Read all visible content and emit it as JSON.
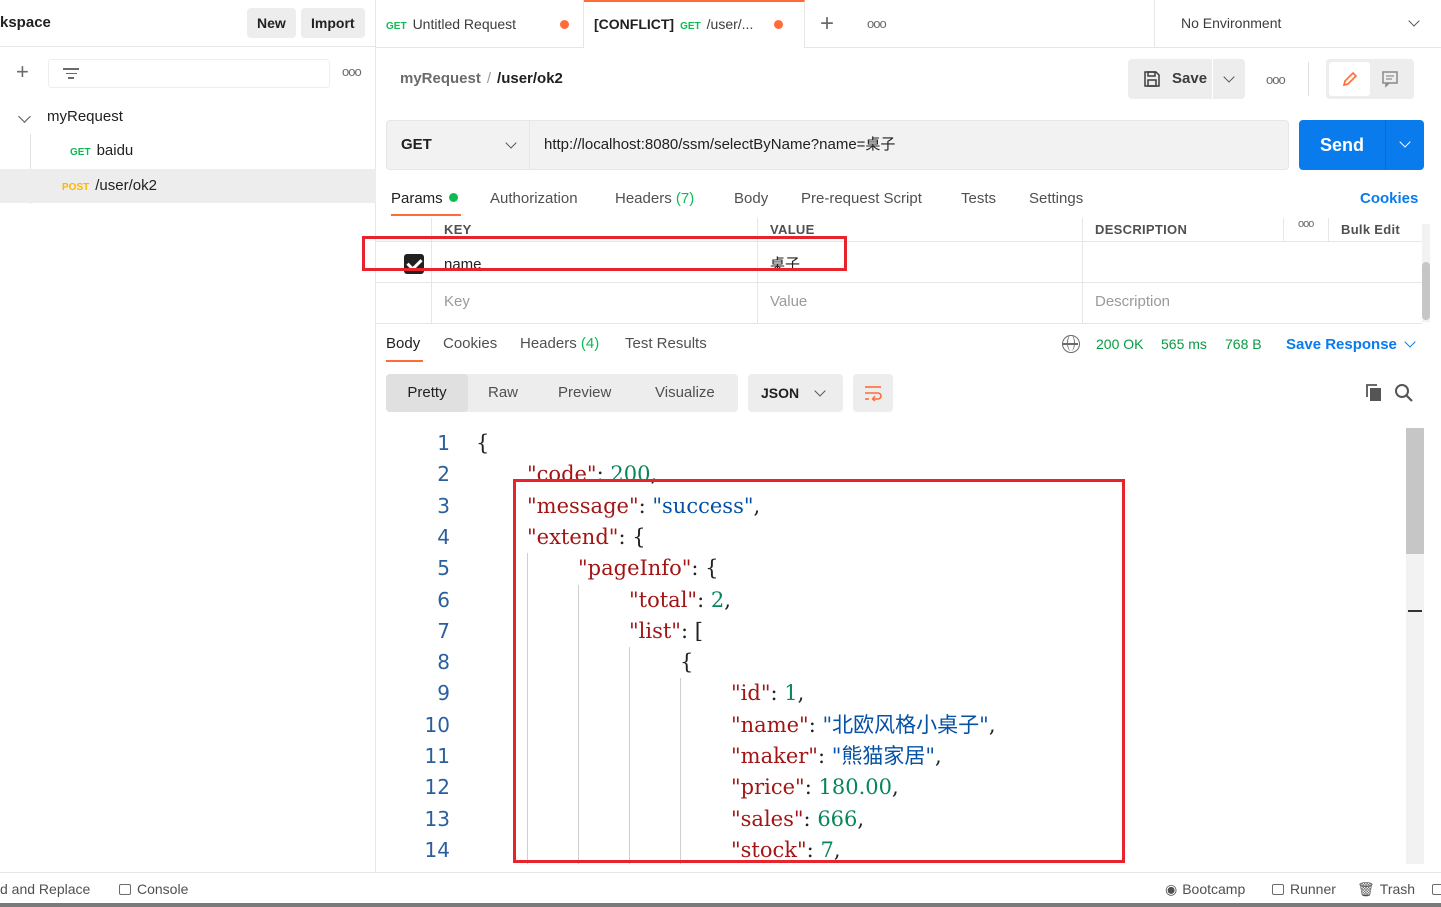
{
  "sidebar": {
    "workspace_title": "kspace",
    "new_label": "New",
    "import_label": "Import",
    "collection_name": "myRequest",
    "items": [
      {
        "method": "GET",
        "name": "baidu"
      },
      {
        "method": "POST",
        "name": "/user/ok2"
      }
    ]
  },
  "tabs": [
    {
      "method": "GET",
      "title": "Untitled Request",
      "prefix": ""
    },
    {
      "method": "GET",
      "title": "/user/...",
      "prefix": "[CONFLICT]"
    }
  ],
  "environment": "No Environment",
  "breadcrumb": {
    "parent": "myRequest",
    "separator": "/",
    "current": "/user/ok2"
  },
  "toolbar": {
    "save_label": "Save"
  },
  "request": {
    "method": "GET",
    "url": "http://localhost:8080/ssm/selectByName?name=桌子",
    "send_label": "Send"
  },
  "request_tabs": {
    "params": "Params",
    "authorization": "Authorization",
    "headers": "Headers",
    "headers_count": "(7)",
    "body": "Body",
    "prerequest": "Pre-request Script",
    "tests": "Tests",
    "settings": "Settings",
    "cookies": "Cookies"
  },
  "params_table": {
    "headers": {
      "key": "KEY",
      "value": "VALUE",
      "description": "DESCRIPTION",
      "bulk_edit": "Bulk Edit"
    },
    "rows": [
      {
        "key": "name",
        "value": "桌子",
        "checked": true
      }
    ],
    "placeholders": {
      "key": "Key",
      "value": "Value",
      "description": "Description"
    }
  },
  "response": {
    "tabs": {
      "body": "Body",
      "cookies": "Cookies",
      "headers": "Headers",
      "headers_count": "(4)",
      "test_results": "Test Results"
    },
    "status": "200 OK",
    "time": "565 ms",
    "size": "768 B",
    "save_response": "Save Response",
    "views": {
      "pretty": "Pretty",
      "raw": "Raw",
      "preview": "Preview",
      "visualize": "Visualize"
    },
    "format": "JSON",
    "code_lines": [
      {
        "n": "1",
        "ind": 0,
        "parts": [
          [
            "p",
            "{"
          ]
        ]
      },
      {
        "n": "2",
        "ind": 1,
        "parts": [
          [
            "k",
            "\"code\""
          ],
          [
            "p",
            ": "
          ],
          [
            "n",
            "200"
          ],
          [
            "p",
            ","
          ]
        ]
      },
      {
        "n": "3",
        "ind": 1,
        "parts": [
          [
            "k",
            "\"message\""
          ],
          [
            "p",
            ": "
          ],
          [
            "s",
            "\"success\""
          ],
          [
            "p",
            ","
          ]
        ]
      },
      {
        "n": "4",
        "ind": 1,
        "parts": [
          [
            "k",
            "\"extend\""
          ],
          [
            "p",
            ": {"
          ]
        ]
      },
      {
        "n": "5",
        "ind": 2,
        "parts": [
          [
            "k",
            "\"pageInfo\""
          ],
          [
            "p",
            ": {"
          ]
        ]
      },
      {
        "n": "6",
        "ind": 3,
        "parts": [
          [
            "k",
            "\"total\""
          ],
          [
            "p",
            ": "
          ],
          [
            "n",
            "2"
          ],
          [
            "p",
            ","
          ]
        ]
      },
      {
        "n": "7",
        "ind": 3,
        "parts": [
          [
            "k",
            "\"list\""
          ],
          [
            "p",
            ": ["
          ]
        ]
      },
      {
        "n": "8",
        "ind": 4,
        "parts": [
          [
            "p",
            "{"
          ]
        ]
      },
      {
        "n": "9",
        "ind": 5,
        "parts": [
          [
            "k",
            "\"id\""
          ],
          [
            "p",
            ": "
          ],
          [
            "n",
            "1"
          ],
          [
            "p",
            ","
          ]
        ]
      },
      {
        "n": "10",
        "ind": 5,
        "parts": [
          [
            "k",
            "\"name\""
          ],
          [
            "p",
            ": "
          ],
          [
            "s",
            "\"北欧风格小桌子\""
          ],
          [
            "p",
            ","
          ]
        ]
      },
      {
        "n": "11",
        "ind": 5,
        "parts": [
          [
            "k",
            "\"maker\""
          ],
          [
            "p",
            ": "
          ],
          [
            "s",
            "\"熊猫家居\""
          ],
          [
            "p",
            ","
          ]
        ]
      },
      {
        "n": "12",
        "ind": 5,
        "parts": [
          [
            "k",
            "\"price\""
          ],
          [
            "p",
            ": "
          ],
          [
            "n",
            "180.00"
          ],
          [
            "p",
            ","
          ]
        ]
      },
      {
        "n": "13",
        "ind": 5,
        "parts": [
          [
            "k",
            "\"sales\""
          ],
          [
            "p",
            ": "
          ],
          [
            "n",
            "666"
          ],
          [
            "p",
            ","
          ]
        ]
      },
      {
        "n": "14",
        "ind": 5,
        "parts": [
          [
            "k",
            "\"stock\""
          ],
          [
            "p",
            ": "
          ],
          [
            "n",
            "7"
          ],
          [
            "p",
            ","
          ]
        ]
      }
    ]
  },
  "footer": {
    "find_replace": "d and Replace",
    "console": "Console",
    "bootcamp": "Bootcamp",
    "runner": "Runner",
    "trash": "Trash"
  },
  "colors": {
    "accent": "#ff6c37",
    "send": "#097bed",
    "annotation": "#e8232b",
    "success": "#0cbb52"
  }
}
